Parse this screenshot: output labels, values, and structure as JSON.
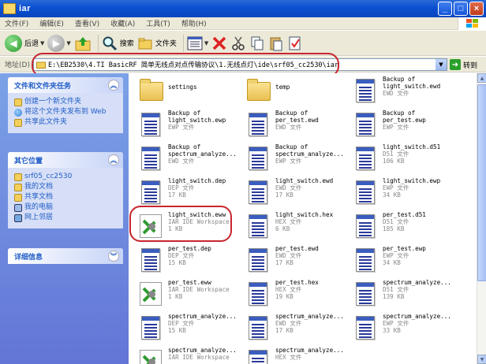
{
  "window": {
    "title": "iar",
    "min": "_",
    "max": "□",
    "close": "×"
  },
  "menu": [
    "文件(F)",
    "编辑(E)",
    "查看(V)",
    "收藏(A)",
    "工具(T)",
    "帮助(H)"
  ],
  "toolbar": {
    "back": "后退",
    "search": "搜索",
    "folders": "文件夹"
  },
  "address": {
    "label": "地址(D)",
    "path": "E:\\EB2530\\4.TI BasicRF 简单无线点对点传输协议\\1.无线点灯\\ide\\srf05_cc2530\\iar",
    "go": "转到"
  },
  "tasks": {
    "header": "文件和文件夹任务",
    "items": [
      "创建一个新文件夹",
      "将这个文件夹发布到 Web",
      "共享此文件夹"
    ]
  },
  "places": {
    "header": "其它位置",
    "items": [
      "srf05_cc2530",
      "我的文档",
      "共享文档",
      "我的电脑",
      "网上邻居"
    ]
  },
  "details": {
    "header": "详细信息"
  },
  "files": [
    {
      "name": "settings",
      "line2": "",
      "line3": "",
      "icon": "folder"
    },
    {
      "name": "temp",
      "line2": "",
      "line3": "",
      "icon": "folder"
    },
    {
      "name": "Backup of",
      "line2": "light_switch.ewd",
      "line3": "EWD 文件",
      "icon": "doc"
    },
    {
      "name": "Backup of",
      "line2": "light_switch.ewp",
      "line3": "EWP 文件",
      "icon": "doc"
    },
    {
      "name": "Backup of",
      "line2": "per_test.ewd",
      "line3": "EWD 文件",
      "icon": "doc"
    },
    {
      "name": "Backup of",
      "line2": "per_test.ewp",
      "line3": "EWP 文件",
      "icon": "doc"
    },
    {
      "name": "Backup of",
      "line2": "spectrum_analyze...",
      "line3": "EWD 文件",
      "icon": "doc"
    },
    {
      "name": "Backup of",
      "line2": "spectrum_analyze...",
      "line3": "EWP 文件",
      "icon": "doc"
    },
    {
      "name": "light_switch.d51",
      "line2": "D51 文件",
      "line3": "106 KB",
      "icon": "doc"
    },
    {
      "name": "light_switch.dep",
      "line2": "DEP 文件",
      "line3": "17 KB",
      "icon": "doc"
    },
    {
      "name": "light_switch.ewd",
      "line2": "EWD 文件",
      "line3": "17 KB",
      "icon": "doc"
    },
    {
      "name": "light_switch.ewp",
      "line2": "EWP 文件",
      "line3": "34 KB",
      "icon": "doc"
    },
    {
      "name": "light_switch.eww",
      "line2": "IAR IDE Workspace",
      "line3": "1 KB",
      "icon": "workspace"
    },
    {
      "name": "light_switch.hex",
      "line2": "HEX 文件",
      "line3": "6 KB",
      "icon": "doc"
    },
    {
      "name": "per_test.d51",
      "line2": "D51 文件",
      "line3": "185 KB",
      "icon": "doc"
    },
    {
      "name": "per_test.dep",
      "line2": "DEP 文件",
      "line3": "15 KB",
      "icon": "doc"
    },
    {
      "name": "per_test.ewd",
      "line2": "EWD 文件",
      "line3": "17 KB",
      "icon": "doc"
    },
    {
      "name": "per_test.ewp",
      "line2": "EWP 文件",
      "line3": "34 KB",
      "icon": "doc"
    },
    {
      "name": "per_test.eww",
      "line2": "IAR IDE Workspace",
      "line3": "1 KB",
      "icon": "workspace"
    },
    {
      "name": "per_test.hex",
      "line2": "HEX 文件",
      "line3": "19 KB",
      "icon": "doc"
    },
    {
      "name": "spectrum_analyze...",
      "line2": "D51 文件",
      "line3": "139 KB",
      "icon": "doc"
    },
    {
      "name": "spectrum_analyze...",
      "line2": "DEP 文件",
      "line3": "15 KB",
      "icon": "doc"
    },
    {
      "name": "spectrum_analyze...",
      "line2": "EWD 文件",
      "line3": "17 KB",
      "icon": "doc"
    },
    {
      "name": "spectrum_analyze...",
      "line2": "EWP 文件",
      "line3": "33 KB",
      "icon": "doc"
    },
    {
      "name": "spectrum_analyze...",
      "line2": "IAR IDE Workspace",
      "line3": "",
      "icon": "workspace"
    },
    {
      "name": "spectrum_analyze...",
      "line2": "HEX 文件",
      "line3": "",
      "icon": "doc"
    }
  ]
}
